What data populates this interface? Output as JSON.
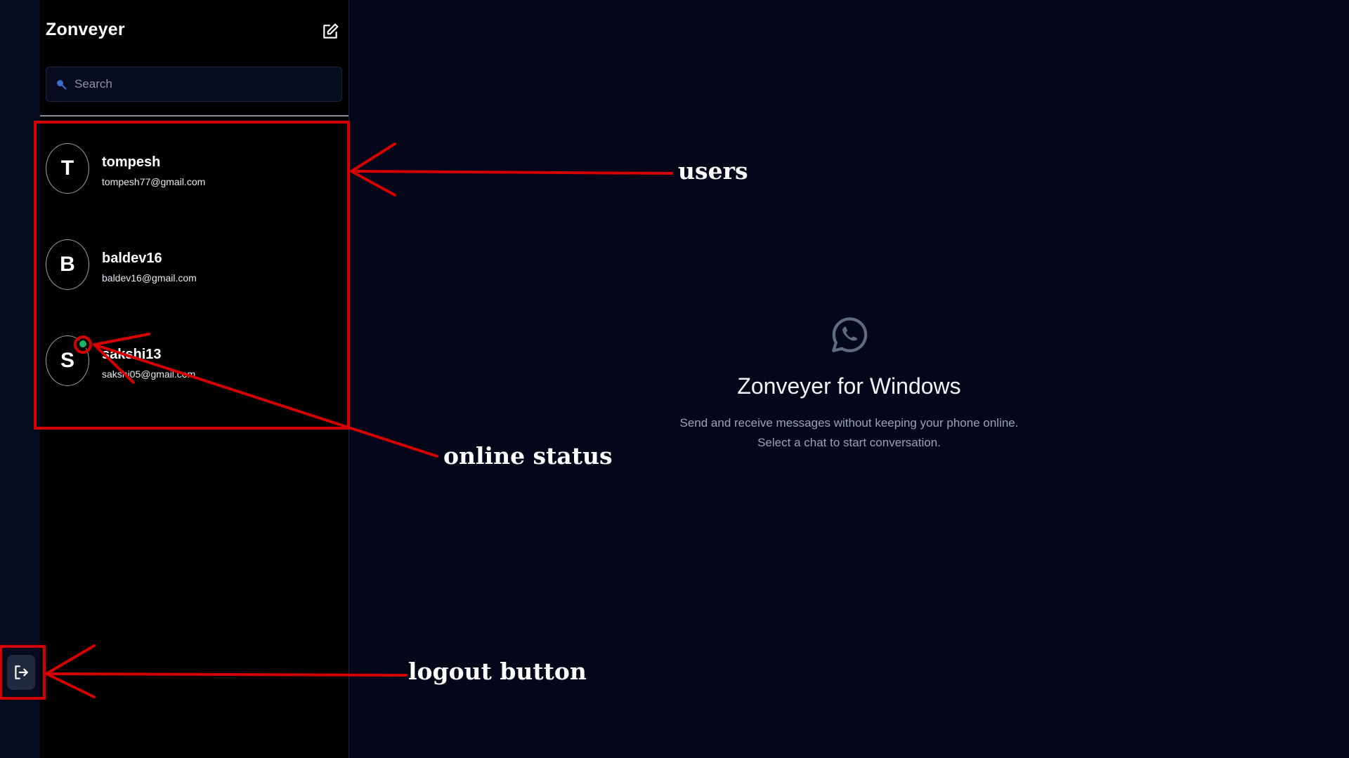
{
  "app": {
    "title": "Zonveyer"
  },
  "search": {
    "placeholder": "Search"
  },
  "users": [
    {
      "initial": "T",
      "name": "tompesh",
      "email": "tompesh77@gmail.com",
      "online": false
    },
    {
      "initial": "B",
      "name": "baldev16",
      "email": "baldev16@gmail.com",
      "online": false
    },
    {
      "initial": "S",
      "name": "sakshi13",
      "email": "sakshi05@gmail.com",
      "online": true
    }
  ],
  "welcome": {
    "title": "Zonveyer for Windows",
    "line1": "Send and receive messages without keeping your phone online.",
    "line2": "Select a chat to start conversation."
  },
  "annotations": {
    "users": "users",
    "online_status": "online status",
    "logout_button": "logout button"
  },
  "colors": {
    "background": "#04061a",
    "sidebar": "#000000",
    "online": "#15b86b",
    "annotation": "#d40000"
  },
  "icons": {
    "compose": "edit-icon",
    "search": "search-icon",
    "logout": "logout-icon",
    "welcome": "whatsapp-icon"
  }
}
